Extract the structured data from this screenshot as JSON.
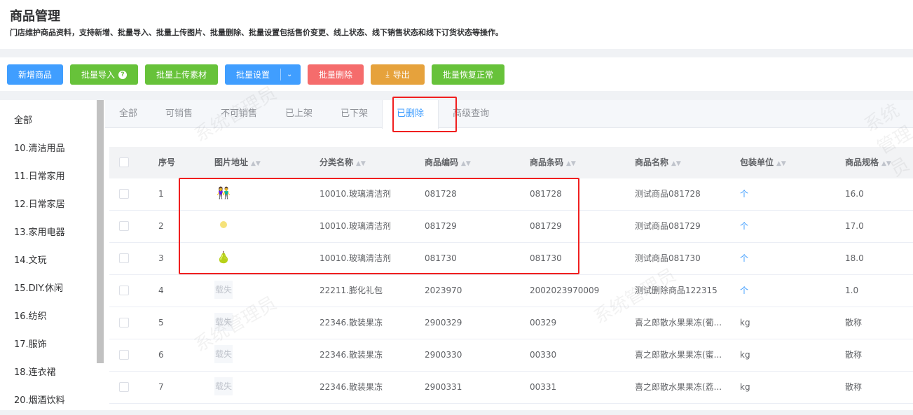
{
  "header": {
    "title": "商品管理",
    "description": "门店维护商品资料，支持新增、批量导入、批量上传图片、批量删除、批量设置包括售价变更、线上状态、线下销售状态和线下订货状态等操作。"
  },
  "toolbar": {
    "add": "新增商品",
    "import": "批量导入",
    "upload": "批量上传素材",
    "settings": "批量设置",
    "delete": "批量删除",
    "export": "导出",
    "restore": "批量恢复正常",
    "help": "?"
  },
  "sidebar": [
    "全部",
    "10.清洁用品",
    "11.日常家用",
    "12.日常家居",
    "13.家用电器",
    "14.文玩",
    "15.DIY.休闲",
    "16.纺织",
    "17.服饰",
    "18.连衣裙",
    "20.烟酒饮料"
  ],
  "tabs": [
    "全部",
    "可销售",
    "不可销售",
    "已上架",
    "已下架",
    "已删除",
    "高级查询"
  ],
  "active_tab": "已删除",
  "watermark": "系统管理员",
  "columns": [
    "序号",
    "图片地址",
    "分类名称",
    "商品编码",
    "商品条码",
    "商品名称",
    "包装单位",
    "商品规格"
  ],
  "image_failed": "载失",
  "rows": [
    {
      "no": "1",
      "img": "people",
      "cat": "10010.玻璃清洁剂",
      "code": "081728",
      "barcode": "081728",
      "name": "测试商品081728",
      "unit": "个",
      "spec": "16.0"
    },
    {
      "no": "2",
      "img": "dot",
      "cat": "10010.玻璃清洁剂",
      "code": "081729",
      "barcode": "081729",
      "name": "测试商品081729",
      "unit": "个",
      "spec": "17.0"
    },
    {
      "no": "3",
      "img": "pear",
      "cat": "10010.玻璃清洁剂",
      "code": "081730",
      "barcode": "081730",
      "name": "测试商品081730",
      "unit": "个",
      "spec": "18.0"
    },
    {
      "no": "4",
      "img": "failed",
      "cat": "22211.膨化礼包",
      "code": "2023970",
      "barcode": "2002023970009",
      "name": "测试删除商品122315",
      "unit": "个",
      "spec": "1.0"
    },
    {
      "no": "5",
      "img": "failed",
      "cat": "22346.散装果冻",
      "code": "2900329",
      "barcode": "00329",
      "name": "喜之郎散水果果冻(葡...",
      "unit": "kg",
      "spec": "散称"
    },
    {
      "no": "6",
      "img": "failed",
      "cat": "22346.散装果冻",
      "code": "2900330",
      "barcode": "00330",
      "name": "喜之郎散水果果冻(蜜...",
      "unit": "kg",
      "spec": "散称"
    },
    {
      "no": "7",
      "img": "failed",
      "cat": "22346.散装果冻",
      "code": "2900331",
      "barcode": "00331",
      "name": "喜之郎散水果果冻(荔...",
      "unit": "kg",
      "spec": "散称"
    }
  ]
}
